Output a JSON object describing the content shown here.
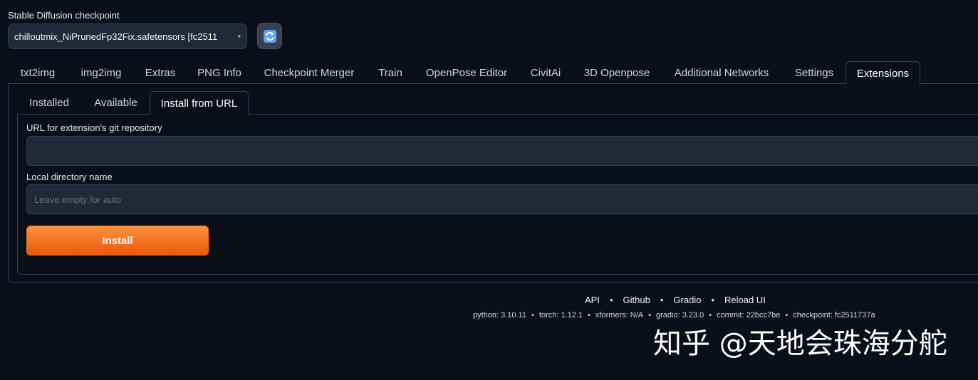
{
  "checkpoint": {
    "label": "Stable Diffusion checkpoint",
    "value": "chilloutmix_NiPrunedFp32Fix.safetensors [fc2511",
    "refresh_icon": "refresh-icon"
  },
  "main_tabs": [
    {
      "label": "txt2img"
    },
    {
      "label": "img2img"
    },
    {
      "label": "Extras"
    },
    {
      "label": "PNG Info"
    },
    {
      "label": "Checkpoint Merger"
    },
    {
      "label": "Train"
    },
    {
      "label": "OpenPose Editor"
    },
    {
      "label": "CivitAi"
    },
    {
      "label": "3D Openpose"
    },
    {
      "label": "Additional Networks"
    },
    {
      "label": "Settings"
    },
    {
      "label": "Extensions",
      "active": true
    }
  ],
  "sub_tabs": [
    {
      "label": "Installed"
    },
    {
      "label": "Available"
    },
    {
      "label": "Install from URL",
      "active": true
    }
  ],
  "form": {
    "url_label": "URL for extension's git repository",
    "url_value": "",
    "dir_label": "Local directory name",
    "dir_placeholder": "Leave empty for auto",
    "install_label": "Install"
  },
  "footer": {
    "links": [
      "API",
      "Github",
      "Gradio",
      "Reload UI"
    ],
    "versions": [
      "python: 3.10.11",
      "torch: 1.12.1",
      "xformers: N/A",
      "gradio: 3.23.0",
      "commit: 22bcc7be",
      "checkpoint: fc2511737a"
    ]
  },
  "watermark": "知乎 @天地会珠海分舵",
  "colors": {
    "background": "#0b0f19",
    "accent": "#ea580c"
  }
}
